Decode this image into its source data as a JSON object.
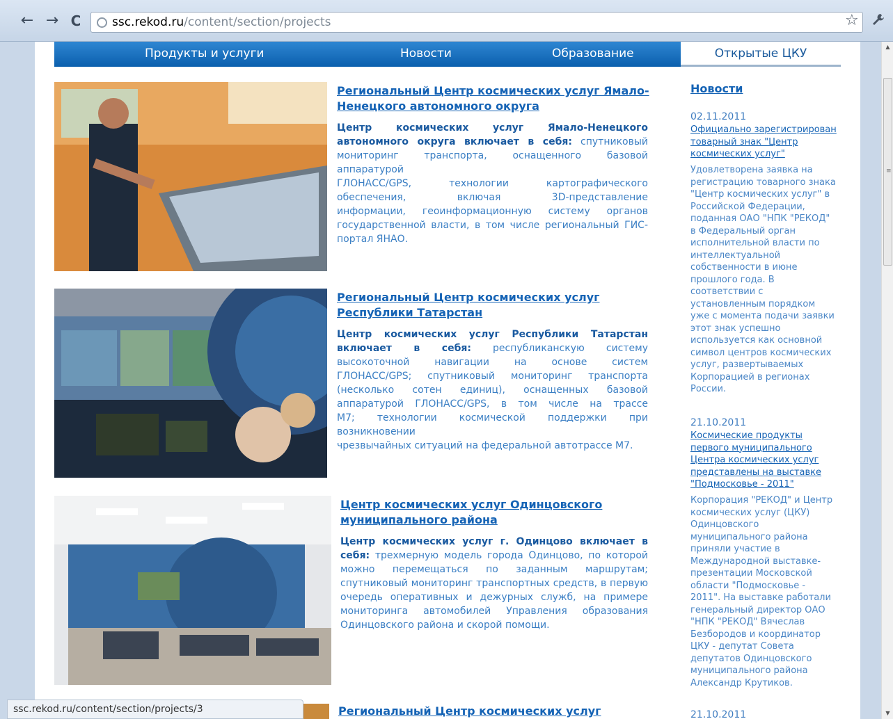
{
  "browser": {
    "url_host": "ssc.rekod.ru",
    "url_path": "/content/section/projects",
    "back_icon": "←",
    "forward_icon": "→",
    "reload_icon": "C",
    "star_icon": "☆",
    "wrench_icon": "🔧"
  },
  "menu": {
    "items": [
      {
        "label": "Продукты и услуги"
      },
      {
        "label": "Новости"
      },
      {
        "label": "Образование"
      }
    ],
    "active": "Открытые ЦКУ"
  },
  "projects": [
    {
      "title_line1": "Региональный Центр космических услуг Ямало-",
      "title_line2": "Ненецкого автономного округа",
      "lines": [
        [
          "Центр космических услуг Ямало-Ненецкого",
          ""
        ],
        [
          "автономного округа включает в себя:",
          " спутниковый"
        ],
        [
          "",
          "мониторинг транспорта, оснащенного базовой аппаратурой"
        ],
        [
          "",
          "ГЛОНАСС/GPS, технологии картографического"
        ],
        [
          "",
          "обеспечения, включая 3D-представление"
        ],
        [
          "",
          "информации, геоинформационную систему органов"
        ],
        [
          "",
          "государственной власти, в том числе региональный ГИС-"
        ],
        [
          "",
          "портал ЯНАО."
        ]
      ]
    },
    {
      "title_line1": "Региональный Центр космических услуг",
      "title_line2": "Республики Татарстан",
      "lines": [
        [
          "Центр космических услуг Республики Татарстан",
          ""
        ],
        [
          "включает в себя:",
          " республиканскую систему"
        ],
        [
          "",
          "высокоточной навигации на основе систем"
        ],
        [
          "",
          "ГЛОНАСС/GPS; спутниковый мониторинг транспорта"
        ],
        [
          "",
          "(несколько сотен единиц), оснащенных базовой"
        ],
        [
          "",
          "аппаратурой ГЛОНАСС/GPS, в том числе на трассе"
        ],
        [
          "",
          "М7; технологии космической поддержки при возникновении"
        ],
        [
          "",
          "чрезвычайных ситуаций на федеральной автотрассе М7."
        ]
      ]
    },
    {
      "title_line1": "Центр космических услуг Одинцовского",
      "title_line2": "муниципального района",
      "lines": [
        [
          "Центр космических услуг г. Одинцово включает в",
          ""
        ],
        [
          "себя:",
          " трехмерную модель города Одинцово, по которой"
        ],
        [
          "",
          "можно перемещаться по заданным маршрутам;"
        ],
        [
          "",
          "спутниковый мониторинг транспортных средств, в первую"
        ],
        [
          "",
          "очередь оперативных и дежурных служб, на примере"
        ],
        [
          "",
          "мониторинга автомобилей Управления образования"
        ],
        [
          "",
          "Одинцовского района и скорой помощи."
        ]
      ]
    },
    {
      "title_line1": "Региональный Центр космических услуг",
      "title_line2": "",
      "lines": []
    }
  ],
  "news": {
    "heading": "Новости",
    "items": [
      {
        "date": "02.11.2011",
        "link": [
          "Официально зарегистрирован",
          "товарный знак \"Центр",
          "космических услуг\""
        ],
        "text": [
          "Удовлетворена заявка на",
          "регистрацию товарного знака",
          "\"Центр космических услуг\" в",
          "Российской Федерации,",
          "поданная ОАО \"НПК \"РЕКОД\"",
          "в Федеральный орган",
          "исполнительной власти по",
          "интеллектуальной",
          "собственности в июне",
          "прошлого года. В",
          "соответствии с",
          "установленным порядком",
          "уже с момента подачи заявки",
          "этот знак успешно",
          "используется как основной",
          "символ центров космических",
          "услуг, развертываемых",
          "Корпорацией в регионах",
          "России."
        ]
      },
      {
        "date": "21.10.2011",
        "link": [
          "Космические продукты",
          "первого муниципального",
          "Центра космических услуг",
          "представлены на выставке",
          "\"Подмосковье - 2011\""
        ],
        "text": [
          "Корпорация \"РЕКОД\" и Центр",
          "космических услуг (ЦКУ)",
          "Одинцовского",
          "муниципального района",
          "приняли участие в",
          "Международной выставке-",
          "презентации Московской",
          "области \"Подмосковье -",
          "2011\". На выставке работали",
          "генеральный директор ОАО",
          "\"НПК \"РЕКОД\" Вячеслав",
          "Безбородов и координатор",
          "ЦКУ - депутат Совета",
          "депутатов Одинцовского",
          "муниципального района",
          "Александр Крутиков."
        ]
      },
      {
        "date": "21.10.2011"
      }
    ]
  },
  "status_url": "ssc.rekod.ru/content/section/projects/3"
}
